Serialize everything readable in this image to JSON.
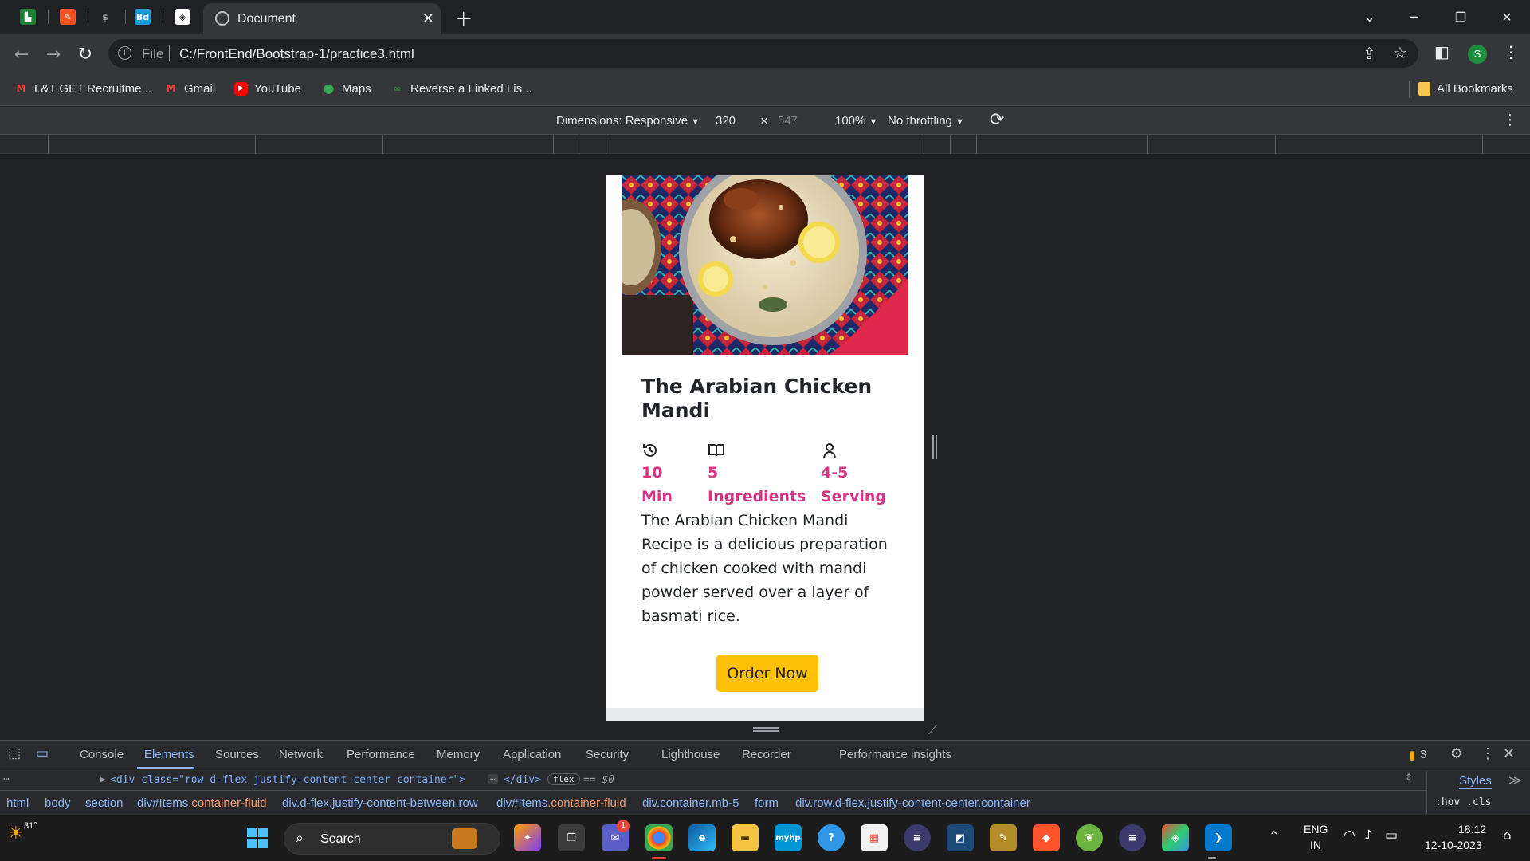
{
  "browser": {
    "active_tab_title": "Document",
    "url_scheme": "File",
    "url": "C:/FrontEnd/Bootstrap-1/practice3.html",
    "profile_initial": "S",
    "pinned_tab_labels": [
      "",
      "",
      "",
      "Bd",
      ""
    ]
  },
  "bookmarks": {
    "items": [
      {
        "label": "L&T GET Recruitme..."
      },
      {
        "label": "Gmail"
      },
      {
        "label": "YouTube"
      },
      {
        "label": "Maps"
      },
      {
        "label": "Reverse a Linked Lis..."
      }
    ],
    "all_bookmarks": "All Bookmarks"
  },
  "device_toolbar": {
    "dimensions": "Dimensions: Responsive",
    "width": "320",
    "times": "×",
    "height": "547",
    "zoom": "100%",
    "throttling": "No throttling"
  },
  "card": {
    "title": "The Arabian Chicken Mandi",
    "stats": [
      {
        "icon": "history-icon",
        "value": "10 Min"
      },
      {
        "icon": "book-icon",
        "value": "5 Ingredients"
      },
      {
        "icon": "person-icon",
        "value": "4-5 Serving"
      }
    ],
    "description": "The Arabian Chicken Mandi Recipe is a delicious preparation of chicken cooked with mandi powder served over a layer of basmati rice.",
    "button_label": "Order Now",
    "colors": {
      "accent": "#d63384",
      "button": "#ffc107"
    }
  },
  "devtools": {
    "tabs": [
      "Console",
      "Elements",
      "Sources",
      "Network",
      "Performance",
      "Memory",
      "Application",
      "Security",
      "Lighthouse",
      "Recorder",
      "Performance insights"
    ],
    "active_tab": "Elements",
    "issues_count": "3",
    "dom_line": "<div class=\"row d-flex justify-content-center container\">",
    "dom_line_tail": "</div>",
    "flex_badge": "flex",
    "dom_ref": "== $0",
    "breadcrumbs": [
      {
        "tag": "html",
        "cls": ""
      },
      {
        "tag": "body",
        "cls": ""
      },
      {
        "tag": "section",
        "cls": ""
      },
      {
        "tag": "div#Items",
        "cls": ".container-fluid"
      },
      {
        "tag": "div.d-flex.justify-content-between.row",
        "cls": ""
      },
      {
        "tag": "div#Items",
        "cls": ".container-fluid"
      },
      {
        "tag": "div.container.mb-5",
        "cls": ""
      },
      {
        "tag": "form",
        "cls": ""
      },
      {
        "tag": "div.row.d-flex.justify-content-center.container",
        "cls": ""
      }
    ],
    "styles_label": "Styles",
    "styles_filter": ":hov .cls"
  },
  "taskbar": {
    "weather_temp": "31°",
    "search_label": "Search",
    "language_line1": "ENG",
    "language_line2": "IN",
    "time": "18:12",
    "date": "12-10-2023",
    "teams_badge": "1"
  }
}
